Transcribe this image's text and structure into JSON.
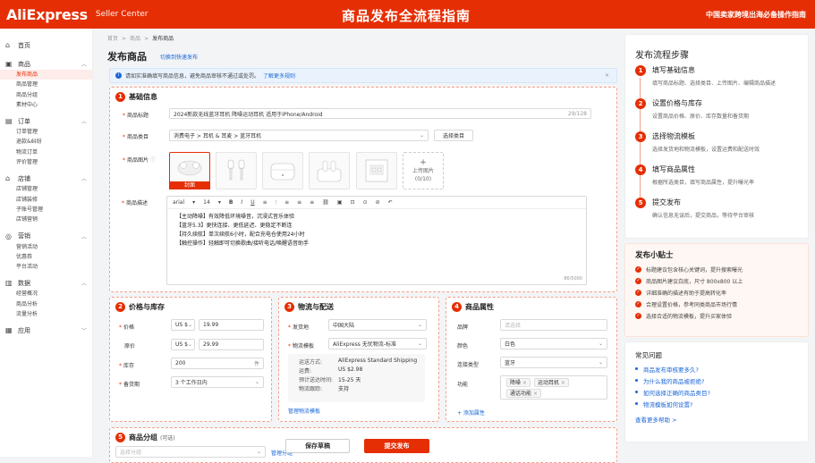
{
  "header": {
    "brand": "AliExpress",
    "seller_center": "Seller Center",
    "banner": "商品发布全流程指南",
    "right": "中国卖家跨境出海必备操作指南"
  },
  "sidebar": {
    "home": "首页",
    "groups": [
      {
        "label": "商品",
        "items": [
          "发布商品",
          "商品管理",
          "商品分组",
          "素材中心"
        ]
      },
      {
        "label": "订单",
        "items": [
          "订单管理",
          "退款&纠纷",
          "物流订单",
          "评价管理"
        ]
      },
      {
        "label": "店铺",
        "items": [
          "店铺管理",
          "店铺装修",
          "子账号管理",
          "店铺营销"
        ]
      },
      {
        "label": "营销",
        "items": [
          "营销活动",
          "优惠券",
          "平台活动"
        ]
      },
      {
        "label": "数据",
        "items": [
          "经营概况",
          "商品分析",
          "流量分析"
        ]
      },
      {
        "label": "应用",
        "items": []
      }
    ]
  },
  "breadcrumb": [
    "首页",
    ">",
    "商品",
    ">",
    "发布商品"
  ],
  "page_title": "发布商品",
  "quick_link": "切换到快速发布",
  "notice": {
    "text": "请如实准确填写商品信息，避免商品审核不通过或处罚。",
    "link": "了解更多规则"
  },
  "basic": {
    "title": "基础信息",
    "name_label": "商品标题",
    "name_value": "2024新款无线蓝牙耳机 降噪运动耳机 适用于iPhone/Android",
    "name_count": "29/128",
    "cat_label": "商品类目",
    "cat_value": "消费电子 > 耳机 & 耳麦 > 蓝牙耳机",
    "cat_button": "选择类目",
    "img_label": "商品图片",
    "cover": "封面",
    "upload": "上传图片",
    "upload_count": "(0/10)",
    "desc_label": "商品描述",
    "toolbar": [
      "arial",
      "▾",
      "14",
      "▾",
      "B",
      "I",
      "U",
      "≡",
      "⫶",
      "≡",
      "≡",
      "≡",
      "⛓",
      "▣",
      "⊡",
      "⊙",
      "⊘",
      "↶"
    ],
    "desc_lines": [
      "【主动降噪】有效降低环境噪音，沉浸式音乐体验",
      "【蓝牙5.3】更快连接、更低延迟、更稳定不断连",
      "【持久续航】单次续航6小时，配合充电仓使用24小时",
      "【触控操作】轻触即可切换歌曲/接听电话/唤醒语音助手"
    ],
    "desc_count": "86/5000"
  },
  "price": {
    "title": "价格与库存",
    "price_label": "价格",
    "price_cur": "US $",
    "price_val": "19.99",
    "orig_label": "原价",
    "orig_cur": "US $",
    "orig_val": "29.99",
    "stock_label": "库存",
    "stock_val": "200",
    "stock_unit": "件",
    "ship_label": "备货期",
    "ship_val": "3 个工作日内"
  },
  "logistics": {
    "title": "物流与配送",
    "from_label": "发货地",
    "from_val": "中国大陆",
    "tpl_label": "物流模板",
    "tpl_val": "AliExpress 无忧物流-标准",
    "rows": [
      [
        "运送方式:",
        "AliExpress Standard Shipping"
      ],
      [
        "运费:",
        "US $2.98"
      ],
      [
        "预计送达时间:",
        "15-25 天"
      ],
      [
        "物流跟踪:",
        "支持"
      ]
    ],
    "manage": "管理物流模板"
  },
  "attrs": {
    "title": "商品属性",
    "brand_label": "品牌",
    "brand_ph": "请选择",
    "color_label": "颜色",
    "color_val": "白色",
    "conn_label": "连接类型",
    "conn_val": "蓝牙",
    "func_label": "功能",
    "func_tags": [
      "降噪",
      "运动耳机",
      "通话功能"
    ],
    "add": "+ 添加属性"
  },
  "group": {
    "title": "商品分组",
    "optional": "(可选)",
    "ph": "选择分组",
    "manage": "管理分组"
  },
  "actions": {
    "save": "保存草稿",
    "submit": "提交发布"
  },
  "flow": {
    "title": "发布流程步骤",
    "steps": [
      {
        "n": "1",
        "t": "填写基础信息",
        "d": "填写商品标题、选择类目、上传图片、编辑商品描述"
      },
      {
        "n": "2",
        "t": "设置价格与库存",
        "d": "设置商品价格、原价、库存数量和备货期"
      },
      {
        "n": "3",
        "t": "选择物流模板",
        "d": "选择发货地和物流模板，设置运费和配送时效"
      },
      {
        "n": "4",
        "t": "填写商品属性",
        "d": "根据所选类目，填写商品属性，提升曝光率"
      },
      {
        "n": "5",
        "t": "提交发布",
        "d": "确认信息无误后，提交商品，等待平台审核"
      }
    ]
  },
  "tips": {
    "title": "发布小贴士",
    "items": [
      "标题建议包含核心关键词，提升搜索曝光",
      "商品图片建议白底，尺寸 800x800 以上",
      "详细准确的描述有助于提高转化率",
      "合理设置价格，参考同类商品市场行情",
      "选择合适的物流模板，提升买家体验"
    ]
  },
  "faq": {
    "title": "常见问题",
    "items": [
      "商品发布审核要多久?",
      "为什么我的商品被拒绝?",
      "如何选择正确的商品类目?",
      "物流模板如何设置?"
    ],
    "more": "查看更多帮助 >"
  },
  "colors": {
    "brand": "#e62e04",
    "link": "#1a66d6"
  }
}
